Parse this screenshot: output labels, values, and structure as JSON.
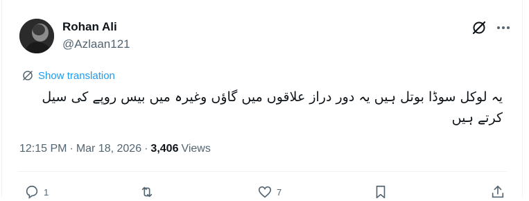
{
  "author": {
    "name": "Rohan Ali",
    "handle": "@Azlaan121"
  },
  "translate_label": "Show translation",
  "tweet_text": "یہ لوکل سوڈا بوتل ہیں یہ دور دراز علاقوں میں گاؤں وغیرہ میں بیس روپے کی سیل کرتے ہیں",
  "meta": {
    "time": "12:15 PM",
    "separator": "·",
    "date": "Mar 18, 2026",
    "views_count": "3,406",
    "views_label": "Views"
  },
  "actions": {
    "reply_count": "1",
    "repost_count": "",
    "like_count": "7"
  },
  "icons": {
    "grok": "grok-icon",
    "more": "more-icon",
    "translate": "translate-icon",
    "reply": "reply-icon",
    "repost": "repost-icon",
    "like": "like-icon",
    "bookmark": "bookmark-icon",
    "share": "share-icon"
  },
  "colors": {
    "accent": "#1d9bf0",
    "secondary_text": "#536471",
    "primary_text": "#0f1419"
  }
}
